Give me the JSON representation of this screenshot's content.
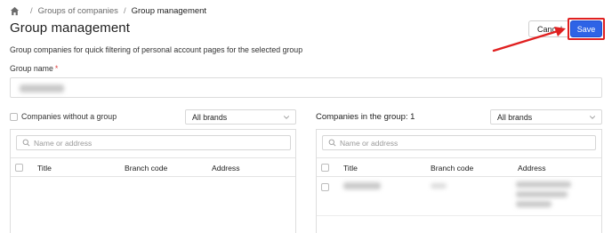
{
  "breadcrumb": {
    "items": [
      "Groups of companies",
      "Group management"
    ]
  },
  "page": {
    "title": "Group management",
    "subtitle": "Group companies for quick filtering of personal account pages for the selected group"
  },
  "actions": {
    "cancel_label": "Cancel",
    "save_label": "Save"
  },
  "form": {
    "group_name_label": "Group name",
    "required_mark": "*"
  },
  "left_panel": {
    "checkbox_label": "Companies without a group",
    "brand_select": "All brands",
    "search_placeholder": "Name or address",
    "columns": [
      "Title",
      "Branch code",
      "Address"
    ]
  },
  "right_panel": {
    "heading_prefix": "Companies in the group:",
    "heading_count": "1",
    "brand_select": "All brands",
    "search_placeholder": "Name or address",
    "columns": [
      "Title",
      "Branch code",
      "Address"
    ]
  },
  "colors": {
    "accent": "#2e63e6",
    "highlight": "#e02020"
  }
}
